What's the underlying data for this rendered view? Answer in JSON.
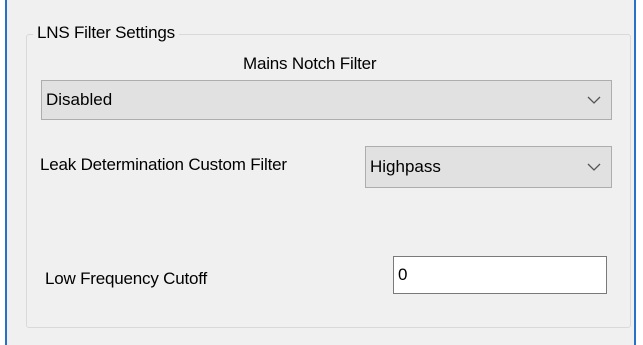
{
  "group": {
    "title": "LNS Filter Settings"
  },
  "mains_notch": {
    "label": "Mains Notch Filter",
    "selected": "Disabled"
  },
  "leak_filter": {
    "label": "Leak Determination Custom Filter",
    "selected": "Highpass"
  },
  "low_cutoff": {
    "label": "Low Frequency Cutoff",
    "value": "0"
  },
  "icons": {
    "dropdown": "chevron-down-icon"
  }
}
